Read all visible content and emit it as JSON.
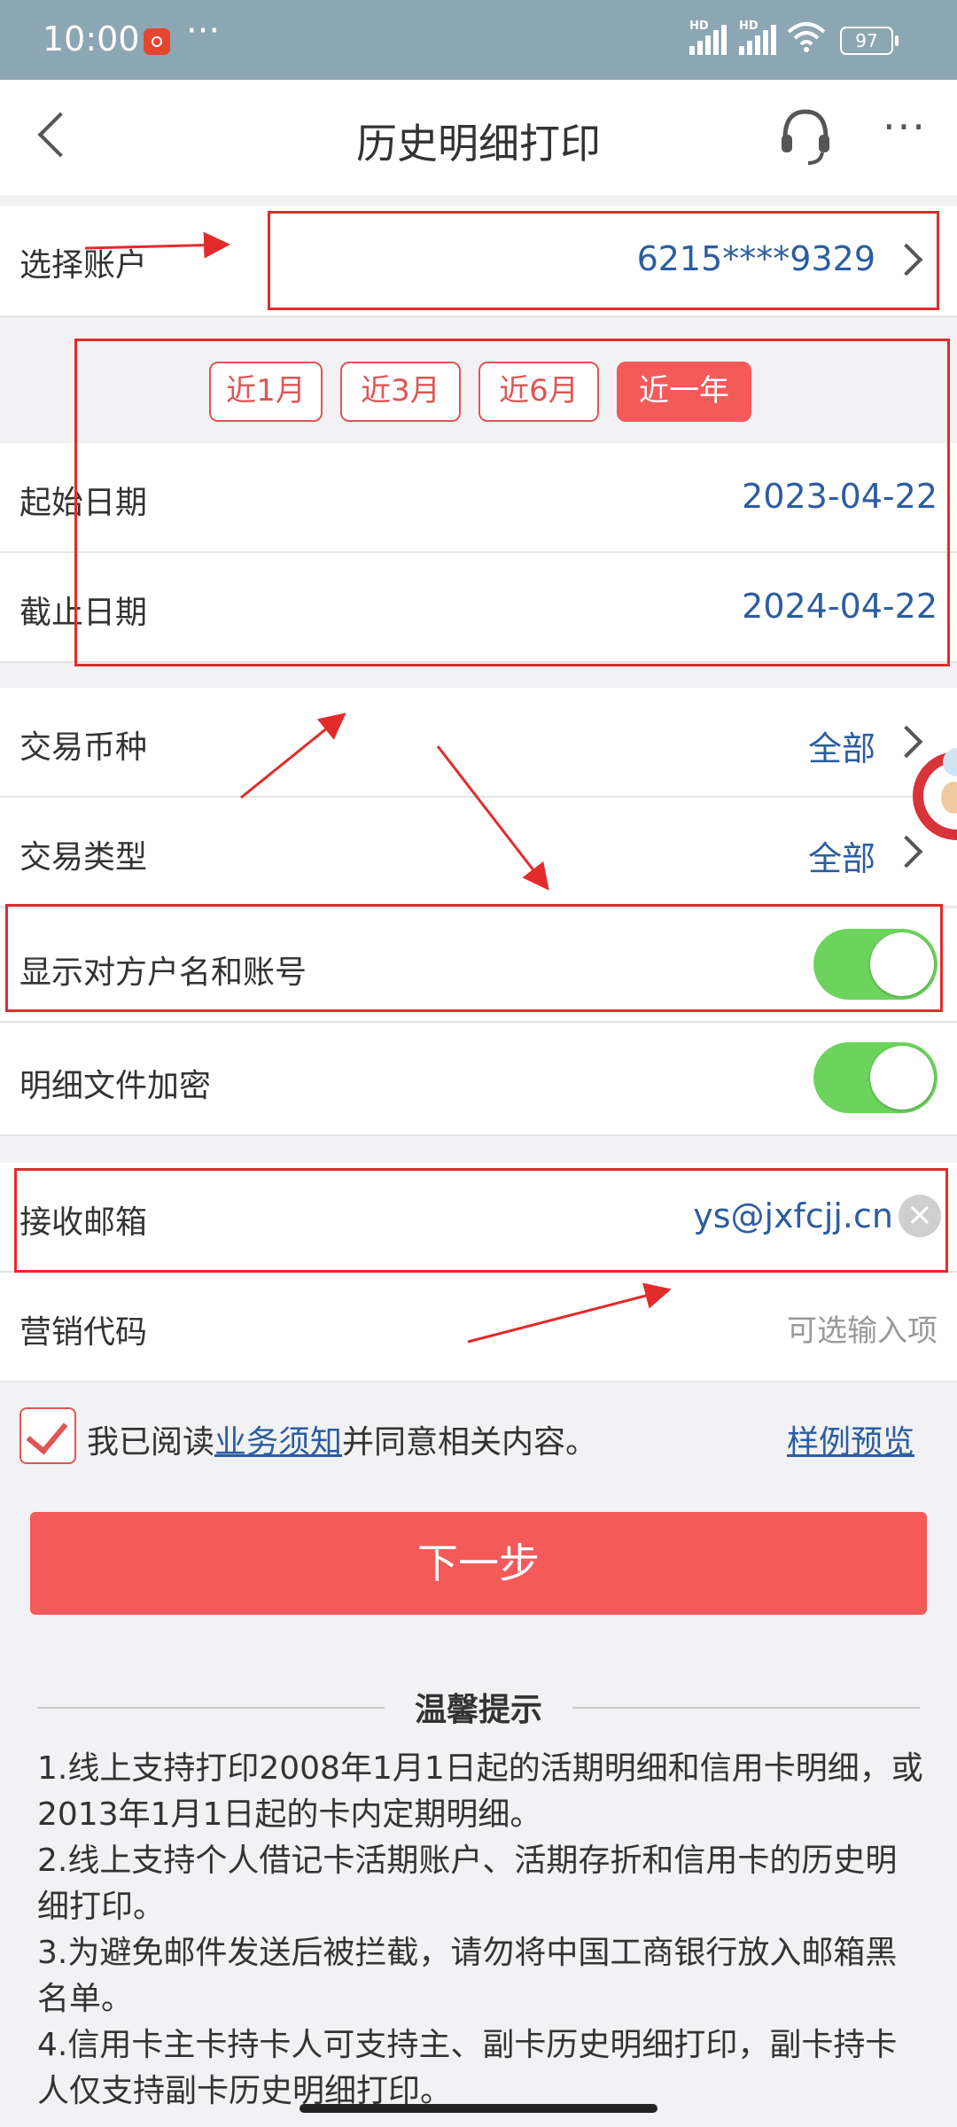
{
  "status": {
    "time": "10:00",
    "battery": "97"
  },
  "header": {
    "title": "历史明细打印"
  },
  "account": {
    "label": "选择账户",
    "value": "6215****9329"
  },
  "ranges": [
    "近1月",
    "近3月",
    "近6月",
    "近一年"
  ],
  "dates": {
    "start_label": "起始日期",
    "start_value": "2023-04-22",
    "end_label": "截止日期",
    "end_value": "2024-04-22"
  },
  "currency": {
    "label": "交易币种",
    "value": "全部"
  },
  "txn_type": {
    "label": "交易类型",
    "value": "全部"
  },
  "show_counterparty": {
    "label": "显示对方户名和账号",
    "on": true
  },
  "encrypt": {
    "label": "明细文件加密",
    "on": true
  },
  "email": {
    "label": "接收邮箱",
    "value": "ys@jxfcjj.cn"
  },
  "promo": {
    "label": "营销代码",
    "placeholder": "可选输入项"
  },
  "agreement": {
    "prefix": "我已阅读",
    "link": "业务须知",
    "suffix": "并同意相关内容。",
    "preview": "样例预览"
  },
  "next_button": "下一步",
  "tips": {
    "title": "温馨提示",
    "items": [
      "1.线上支持打印2008年1月1日起的活期明细和信用卡明细，或2013年1月1日起的卡内定期明细。",
      "2.线上支持个人借记卡活期账户、活期存折和信用卡的历史明细打印。",
      "3.为避免邮件发送后被拦截，请勿将中国工商银行放入邮箱黑名单。",
      "4.信用卡主卡持卡人可支持主、副卡历史明细打印，副卡持卡人仅支持副卡历史明细打印。"
    ]
  }
}
